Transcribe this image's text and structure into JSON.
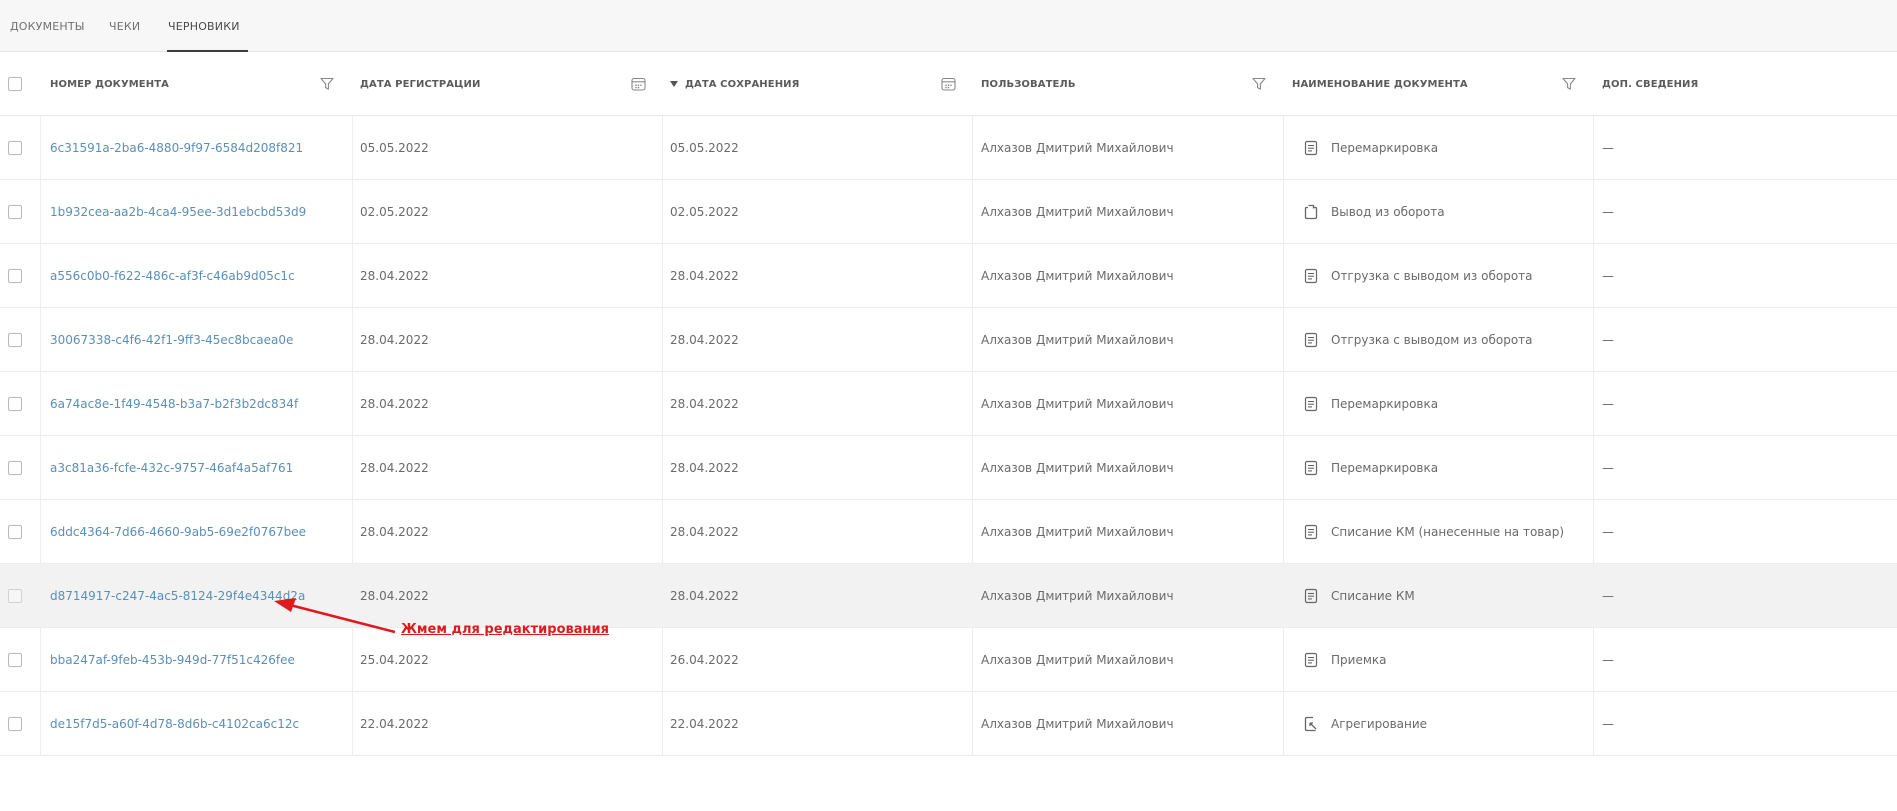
{
  "tabs": [
    {
      "label": "Документы"
    },
    {
      "label": "Чеки"
    },
    {
      "label": "Черновики",
      "active": true
    }
  ],
  "table": {
    "columns": [
      {
        "label": "Номер документа",
        "control": "filter-icon"
      },
      {
        "label": "Дата регистрации",
        "control": "calendar-icon"
      },
      {
        "label": "Дата сохранения",
        "control": "calendar-icon",
        "sort": "desc"
      },
      {
        "label": "Пользователь",
        "control": "filter-icon"
      },
      {
        "label": "Наименование документа",
        "control": "filter-icon"
      },
      {
        "label": "Доп. сведения"
      }
    ],
    "rows": [
      {
        "number": "6c31591a-2ba6-4880-9f97-6584d208f821",
        "reg_date": "05.05.2022",
        "save_date": "05.05.2022",
        "user": "Алхазов Дмитрий Михайлович",
        "doc_icon": "document-icon",
        "doc_name": "Перемаркировка",
        "extra": "—"
      },
      {
        "number": "1b932cea-aa2b-4ca4-95ee-3d1ebcbd53d9",
        "reg_date": "02.05.2022",
        "save_date": "02.05.2022",
        "user": "Алхазов Дмитрий Михайлович",
        "doc_icon": "withdraw-icon",
        "doc_name": "Вывод из оборота",
        "extra": "—"
      },
      {
        "number": "a556c0b0-f622-486c-af3f-c46ab9d05c1c",
        "reg_date": "28.04.2022",
        "save_date": "28.04.2022",
        "user": "Алхазов Дмитрий Михайлович",
        "doc_icon": "document-icon",
        "doc_name": "Отгрузка с выводом из оборота",
        "extra": "—"
      },
      {
        "number": "30067338-c4f6-42f1-9ff3-45ec8bcaea0e",
        "reg_date": "28.04.2022",
        "save_date": "28.04.2022",
        "user": "Алхазов Дмитрий Михайлович",
        "doc_icon": "document-icon",
        "doc_name": "Отгрузка с выводом из оборота",
        "extra": "—"
      },
      {
        "number": "6a74ac8e-1f49-4548-b3a7-b2f3b2dc834f",
        "reg_date": "28.04.2022",
        "save_date": "28.04.2022",
        "user": "Алхазов Дмитрий Михайлович",
        "doc_icon": "document-icon",
        "doc_name": "Перемаркировка",
        "extra": "—"
      },
      {
        "number": "a3c81a36-fcfe-432c-9757-46af4a5af761",
        "reg_date": "28.04.2022",
        "save_date": "28.04.2022",
        "user": "Алхазов Дмитрий Михайлович",
        "doc_icon": "document-icon",
        "doc_name": "Перемаркировка",
        "extra": "—"
      },
      {
        "number": "6ddc4364-7d66-4660-9ab5-69e2f0767bee",
        "reg_date": "28.04.2022",
        "save_date": "28.04.2022",
        "user": "Алхазов Дмитрий Михайлович",
        "doc_icon": "document-icon",
        "doc_name": "Списание КМ (нанесенные на товар)",
        "extra": "—"
      },
      {
        "number": "d8714917-c247-4ac5-8124-29f4e4344d2a",
        "reg_date": "28.04.2022",
        "save_date": "28.04.2022",
        "user": "Алхазов Дмитрий Михайлович",
        "doc_icon": "document-icon",
        "doc_name": "Списание КМ",
        "extra": "—",
        "highlighted": true
      },
      {
        "number": "bba247af-9feb-453b-949d-77f51c426fee",
        "reg_date": "25.04.2022",
        "save_date": "26.04.2022",
        "user": "Алхазов Дмитрий Михайлович",
        "doc_icon": "document-icon",
        "doc_name": "Приемка",
        "extra": "—"
      },
      {
        "number": "de15f7d5-a60f-4d78-8d6b-c4102ca6c12c",
        "reg_date": "22.04.2022",
        "save_date": "22.04.2022",
        "user": "Алхазов Дмитрий Михайлович",
        "doc_icon": "aggregation-icon",
        "doc_name": "Агрегирование",
        "extra": "—"
      }
    ]
  },
  "annotation": {
    "text": "Жмем для редактирования",
    "color": "#e0191d"
  },
  "colors": {
    "link": "#5b8fb6",
    "tab_indicator": "#3d3d3d",
    "highlight_row": "#f2f2f2"
  }
}
